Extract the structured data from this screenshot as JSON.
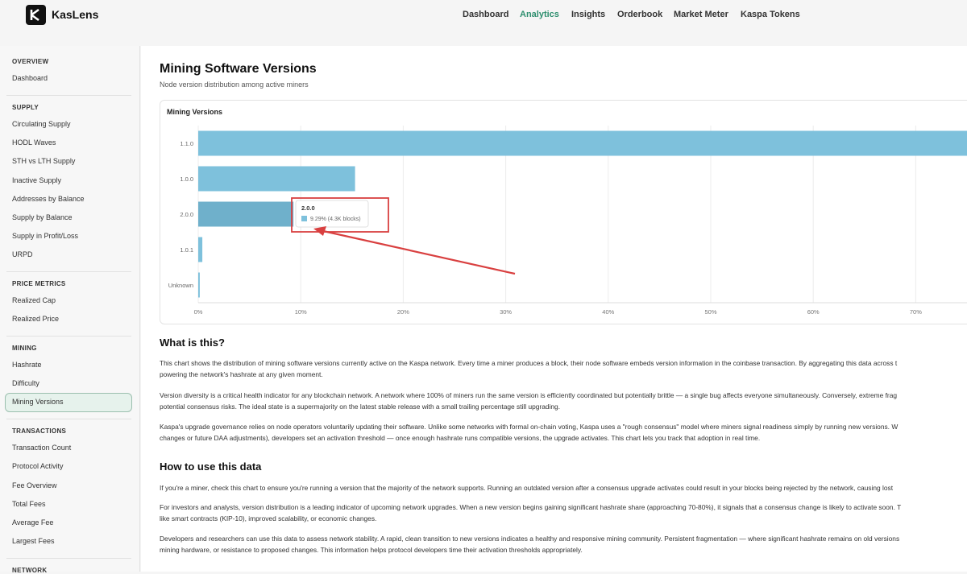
{
  "app": {
    "brand": "KasLens"
  },
  "nav": [
    {
      "label": "Dashboard",
      "active": false
    },
    {
      "label": "Analytics",
      "active": true
    },
    {
      "label": "Insights",
      "active": false
    },
    {
      "label": "Orderbook",
      "active": false
    },
    {
      "label": "Market Meter",
      "active": false
    },
    {
      "label": "Kaspa Tokens",
      "active": false
    }
  ],
  "sidebar": {
    "sections": [
      {
        "title": "OVERVIEW",
        "items": [
          "Dashboard"
        ]
      },
      {
        "title": "SUPPLY",
        "items": [
          "Circulating Supply",
          "HODL Waves",
          "STH vs LTH Supply",
          "Inactive Supply",
          "Addresses by Balance",
          "Supply by Balance",
          "Supply in Profit/Loss",
          "URPD"
        ]
      },
      {
        "title": "PRICE METRICS",
        "items": [
          "Realized Cap",
          "Realized Price"
        ]
      },
      {
        "title": "MINING",
        "items": [
          "Hashrate",
          "Difficulty",
          "Mining Versions"
        ]
      },
      {
        "title": "TRANSACTIONS",
        "items": [
          "Transaction Count",
          "Protocol Activity",
          "Fee Overview",
          "Total Fees",
          "Average Fee",
          "Largest Fees"
        ]
      },
      {
        "title": "NETWORK",
        "items": []
      }
    ],
    "active_item": "Mining Versions"
  },
  "page": {
    "title": "Mining Software Versions",
    "subtitle": "Node version distribution among active miners"
  },
  "chart_data": {
    "type": "bar",
    "orientation": "horizontal",
    "title": "Mining Versions",
    "categories": [
      "1.1.0",
      "1.0.0",
      "2.0.0",
      "1.0.1",
      "Unknown"
    ],
    "values": [
      75.1,
      15.3,
      9.29,
      0.4,
      0.15
    ],
    "x_tick_labels": [
      "0%",
      "10%",
      "20%",
      "30%",
      "40%",
      "50%",
      "60%",
      "70%"
    ],
    "xlim": [
      0,
      75
    ],
    "grid": true,
    "bar_color": "#7ec1dc",
    "tooltip": {
      "title": "2.0.0",
      "text": "9.29% (4.3K blocks)"
    },
    "annotation_color": "#d94040"
  },
  "sections": [
    {
      "heading": "What is this?",
      "paragraphs": [
        [
          "This chart shows the distribution of mining software versions currently active on the Kaspa network. Every time a miner produces a block, their node software embeds version information in the coinbase transaction. By aggregating this data across t",
          "powering the network's hashrate at any given moment."
        ],
        [
          "Version diversity is a critical health indicator for any blockchain network. A network where 100% of miners run the same version is efficiently coordinated but potentially brittle — a single bug affects everyone simultaneously. Conversely, extreme frag",
          "potential consensus risks. The ideal state is a supermajority on the latest stable release with a small trailing percentage still upgrading."
        ],
        [
          "Kaspa's upgrade governance relies on node operators voluntarily updating their software. Unlike some networks with formal on-chain voting, Kaspa uses a \"rough consensus\" model where miners signal readiness simply by running new versions. W",
          "changes or future DAA adjustments), developers set an activation threshold — once enough hashrate runs compatible versions, the upgrade activates. This chart lets you track that adoption in real time."
        ]
      ]
    },
    {
      "heading": "How to use this data",
      "paragraphs": [
        [
          "If you're a miner, check this chart to ensure you're running a version that the majority of the network supports. Running an outdated version after a consensus upgrade activates could result in your blocks being rejected by the network, causing lost"
        ],
        [
          "For investors and analysts, version distribution is a leading indicator of upcoming network upgrades. When a new version begins gaining significant hashrate share (approaching 70-80%), it signals that a consensus change is likely to activate soon. T",
          "like smart contracts (KIP-10), improved scalability, or economic changes."
        ],
        [
          "Developers and researchers can use this data to assess network stability. A rapid, clean transition to new versions indicates a healthy and responsive mining community. Persistent fragmentation — where significant hashrate remains on old versions",
          "mining hardware, or resistance to proposed changes. This information helps protocol developers time their activation thresholds appropriately."
        ]
      ]
    }
  ]
}
